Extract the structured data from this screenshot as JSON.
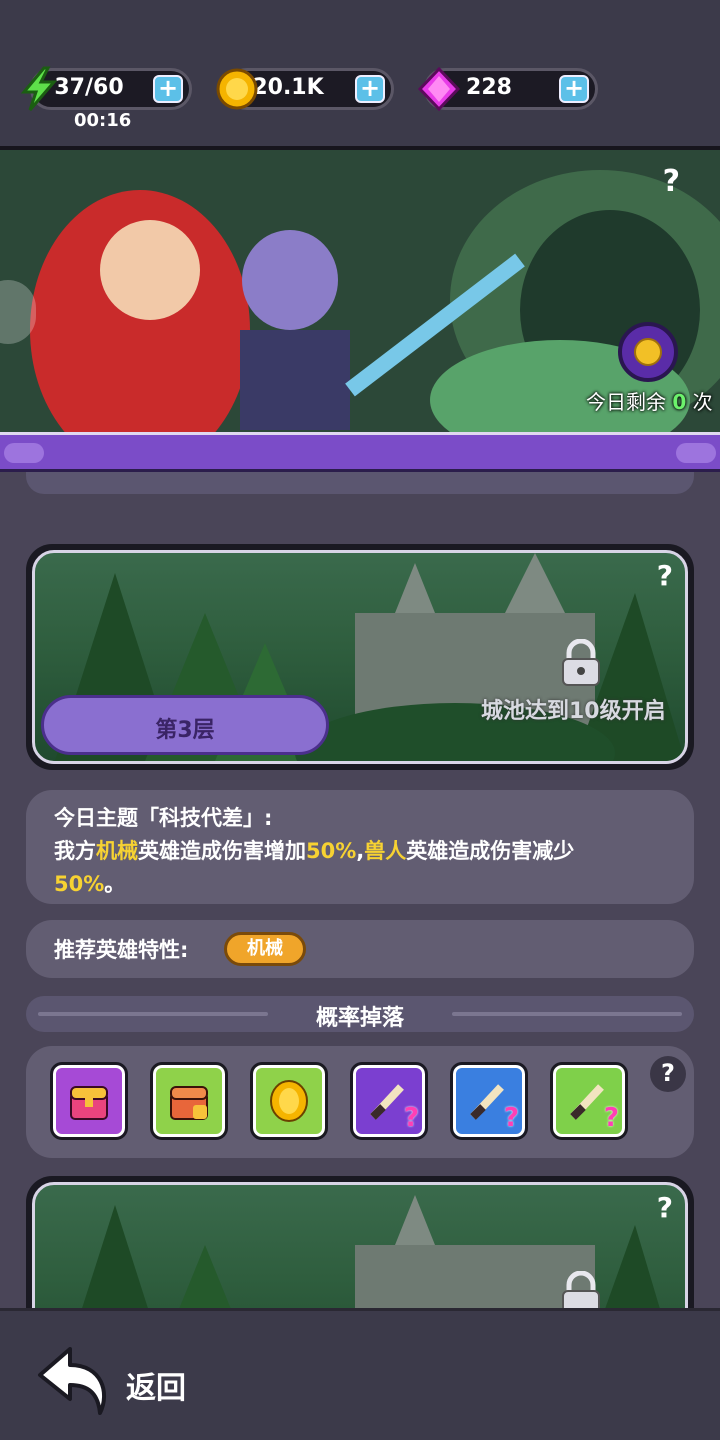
{
  "resources": {
    "energy": {
      "value": "37/60",
      "timer": "00:16",
      "icon": "lightning-icon"
    },
    "coins": {
      "value": "20.1K",
      "icon": "coin-icon"
    },
    "gems": {
      "value": "228",
      "icon": "gem-icon"
    },
    "plus_label": "+"
  },
  "banner": {
    "help": "?",
    "remaining_prefix": "今日剩余",
    "remaining_count": "0",
    "remaining_suffix": "次"
  },
  "floor": {
    "label": "第3层",
    "lock_text": "城池达到10级开启",
    "help": "?"
  },
  "theme": {
    "title": "今日主题「科技代差」:",
    "line1_a": "我方",
    "line1_hl1": "机械",
    "line1_b": "英雄造成伤害增加",
    "line1_hl2": "50%",
    "line1_c": ",",
    "line1_hl3": "兽人",
    "line1_d": "英雄造成伤害减少",
    "line2_hl": "50%",
    "line2_end": "。"
  },
  "recommend": {
    "label": "推荐英雄特性:",
    "trait": "机械"
  },
  "drops": {
    "title": "概率掉落",
    "help": "?",
    "items": [
      {
        "name": "purple-chest-icon",
        "bg": "#a64ad6"
      },
      {
        "name": "orange-chest-icon",
        "bg": "#8fd24a"
      },
      {
        "name": "gold-coin-icon",
        "bg": "#8fd24a"
      },
      {
        "name": "purple-weapon-icon",
        "bg": "#7b3fd0"
      },
      {
        "name": "blue-weapon-icon",
        "bg": "#3a7fe0"
      },
      {
        "name": "green-weapon-icon",
        "bg": "#7fd04a"
      }
    ]
  },
  "footer": {
    "back_label": "返回"
  }
}
